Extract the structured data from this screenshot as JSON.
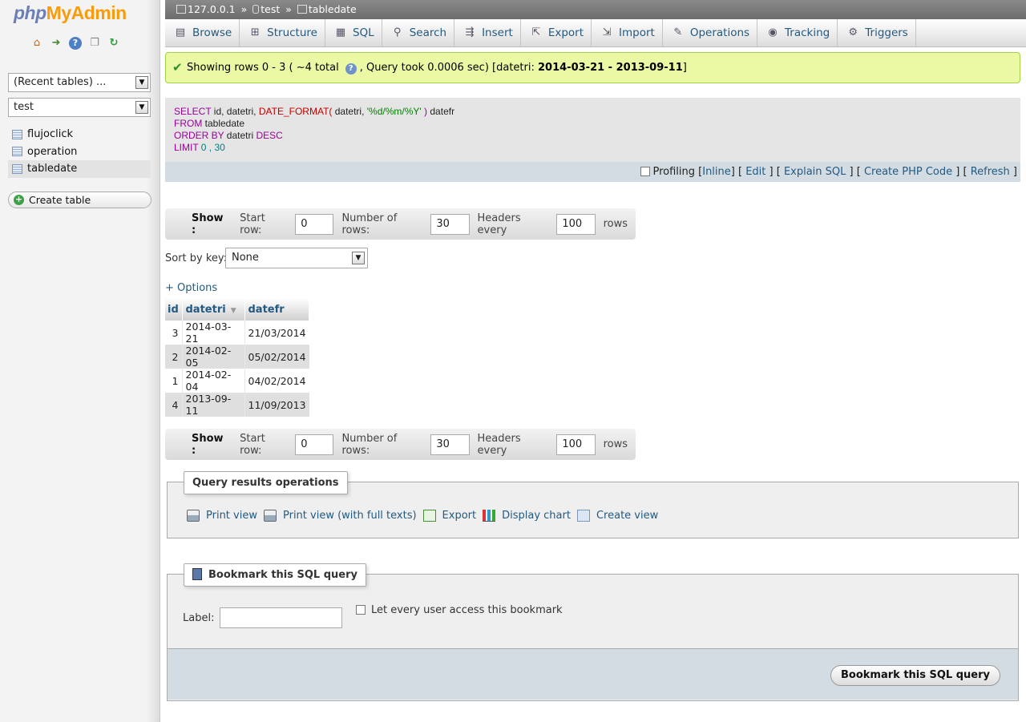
{
  "app": {
    "logo_php": "php",
    "logo_my": "My",
    "logo_admin": "Admin"
  },
  "sidebar": {
    "recent_select": "(Recent tables) ...",
    "db_select": "test",
    "tables": [
      "flujoclick",
      "operation",
      "tabledate"
    ],
    "active_table": "tabledate",
    "create_table": "Create table"
  },
  "breadcrumb": {
    "server": "127.0.0.1",
    "database": "test",
    "table": "tabledate",
    "separator": "»"
  },
  "tabs": [
    {
      "label": "Browse",
      "icon": "browse-icon"
    },
    {
      "label": "Structure",
      "icon": "structure-icon"
    },
    {
      "label": "SQL",
      "icon": "sql-icon"
    },
    {
      "label": "Search",
      "icon": "search-icon"
    },
    {
      "label": "Insert",
      "icon": "insert-icon"
    },
    {
      "label": "Export",
      "icon": "export-icon"
    },
    {
      "label": "Import",
      "icon": "import-icon"
    },
    {
      "label": "Operations",
      "icon": "wrench-icon"
    },
    {
      "label": "Tracking",
      "icon": "eye-icon"
    },
    {
      "label": "Triggers",
      "icon": "triggers-icon"
    }
  ],
  "message": {
    "part1": "Showing rows 0 - 3 ( ~4 total",
    "part2": ", Query took 0.0006 sec) [datetri:",
    "range": "2014-03-21 - 2013-09-11",
    "part3": "]"
  },
  "sql": {
    "select_kw": "SELECT",
    "select_cols": " id, datetri, ",
    "func": "DATE_FORMAT(",
    "func_arg": " datetri, ",
    "format_str": "'%d/%m/%Y'",
    "func_close": " )",
    "alias": " datefr",
    "from_kw": "FROM",
    "from_table": " tabledate",
    "order_kw": "ORDER BY",
    "order_col": " datetri ",
    "desc_kw": "DESC",
    "limit_kw": "LIMIT",
    "limit_vals": " 0 , 30"
  },
  "sql_actions": {
    "profiling": "Profiling",
    "inline": "Inline",
    "edit": "Edit",
    "explain": "Explain SQL",
    "php_code": "Create PHP Code",
    "refresh": "Refresh"
  },
  "navbar": {
    "show": "Show :",
    "start_row_label": "Start row:",
    "start_row": "0",
    "num_rows_label": "Number of rows:",
    "num_rows": "30",
    "headers_label": "Headers every",
    "headers_every": "100",
    "rows_label": "rows"
  },
  "sort": {
    "label": "Sort by key:",
    "value": "None"
  },
  "options_link": "+ Options",
  "table": {
    "headers": [
      "id",
      "datetri",
      "datefr"
    ],
    "rows": [
      [
        "3",
        "2014-03-21",
        "21/03/2014"
      ],
      [
        "2",
        "2014-02-05",
        "05/02/2014"
      ],
      [
        "1",
        "2014-02-04",
        "04/02/2014"
      ],
      [
        "4",
        "2013-09-11",
        "11/09/2013"
      ]
    ]
  },
  "query_ops": {
    "legend": "Query results operations",
    "print_view": "Print view",
    "print_full": "Print view (with full texts)",
    "export": "Export",
    "display_chart": "Display chart",
    "create_view": "Create view"
  },
  "bookmark": {
    "legend": "Bookmark this SQL query",
    "label": "Label:",
    "label_value": "",
    "public": "Let every user access this bookmark",
    "button": "Bookmark this SQL query"
  }
}
